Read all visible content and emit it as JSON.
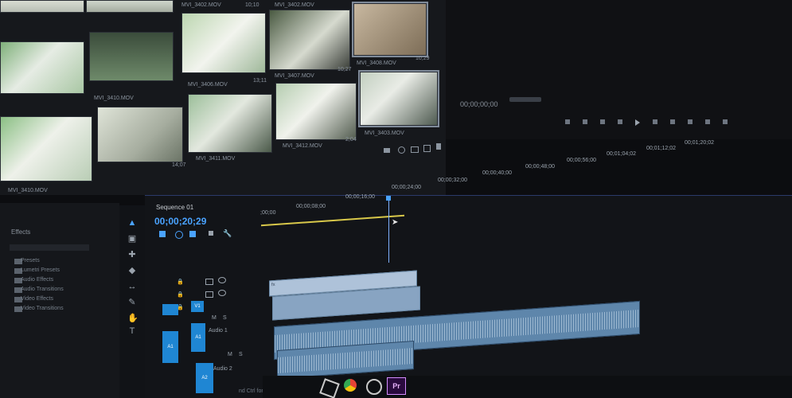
{
  "project": {
    "clips": [
      {
        "name": "MVI_3402.MOV",
        "dur": "10;10"
      },
      {
        "name": "MVI_3405.MOV",
        "dur": "10;29"
      },
      {
        "name": "MVI_3406.MOV",
        "dur": "13;11"
      },
      {
        "name": "MVI_3407.MOV",
        "dur": "10;27"
      },
      {
        "name": "MVI_3408.MOV",
        "dur": "10;29"
      },
      {
        "name": "MVI_3410.MOV",
        "dur": ""
      },
      {
        "name": "MVI_3411.MOV",
        "dur": "14;07"
      },
      {
        "name": "MVI_3412.MOV",
        "dur": "2;04"
      },
      {
        "name": "MVI_3403.MOV",
        "dur": ""
      }
    ]
  },
  "monitor": {
    "timecode": "00;00;00;00"
  },
  "effects": {
    "title": "Effects",
    "items": [
      "Presets",
      "Lumetri Presets",
      "Audio Effects",
      "Audio Transitions",
      "Video Effects",
      "Video Transitions"
    ]
  },
  "timeline": {
    "sequence": "Sequence 01",
    "timecode": "00;00;20;29",
    "ruler": [
      ";00;00",
      "00;00;08;00",
      "00;00;16;00",
      "00;00;24;00",
      "00;00;32;00",
      "00;00;40;00",
      "00;00;48;00",
      "00;00;56;00",
      "00;01;04;02",
      "00;01;12;02",
      "00;01;20;02"
    ],
    "tracks": {
      "v": "V1",
      "a1": "A1",
      "a2": "A2",
      "a1name": "Audio 1",
      "a2name": "Audio 2"
    },
    "fx_badge": "fx"
  },
  "status": {
    "hint": "nd Ctrl for other options."
  },
  "taskbar": {
    "pr_label": "Pr"
  }
}
